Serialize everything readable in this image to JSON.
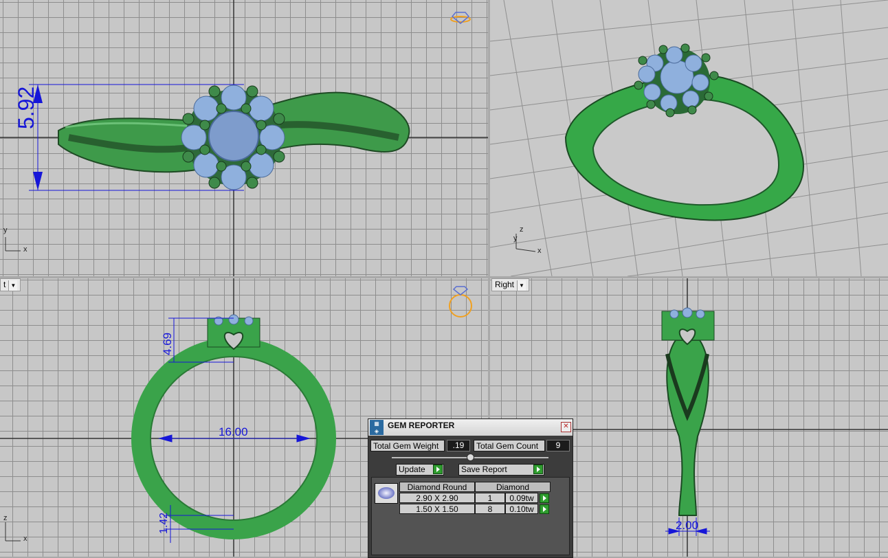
{
  "viewports": {
    "top": {
      "axis_y": "y",
      "axis_x": "x",
      "dimension_height": "5.92"
    },
    "perspective": {
      "axis_z": "z",
      "axis_x": "x",
      "axis_y": "y"
    },
    "front": {
      "label": "t",
      "dimension_head": "4.69",
      "dimension_inner": "16.00",
      "dimension_band": "1.42",
      "axis_z": "z",
      "axis_x": "x"
    },
    "right": {
      "label": "Right",
      "dimension_width": "2.00"
    }
  },
  "gem_reporter": {
    "title": "GEM REPORTER",
    "total_weight_label": "Total Gem Weight",
    "total_weight_value": ".19",
    "total_count_label": "Total Gem Count",
    "total_count_value": "9",
    "update_label": "Update",
    "save_label": "Save Report",
    "table": {
      "headers": [
        "Diamond Round",
        "Diamond"
      ],
      "rows": [
        {
          "size": "2.90 X 2.90",
          "count": "1",
          "weight": "0.09tw"
        },
        {
          "size": "1.50 X 1.50",
          "count": "8",
          "weight": "0.10tw"
        }
      ]
    }
  },
  "colors": {
    "metal": "#3aa34a",
    "gem": "#8fb0dd",
    "dimension": "#1616d8",
    "gizmo": "#f0a020"
  }
}
